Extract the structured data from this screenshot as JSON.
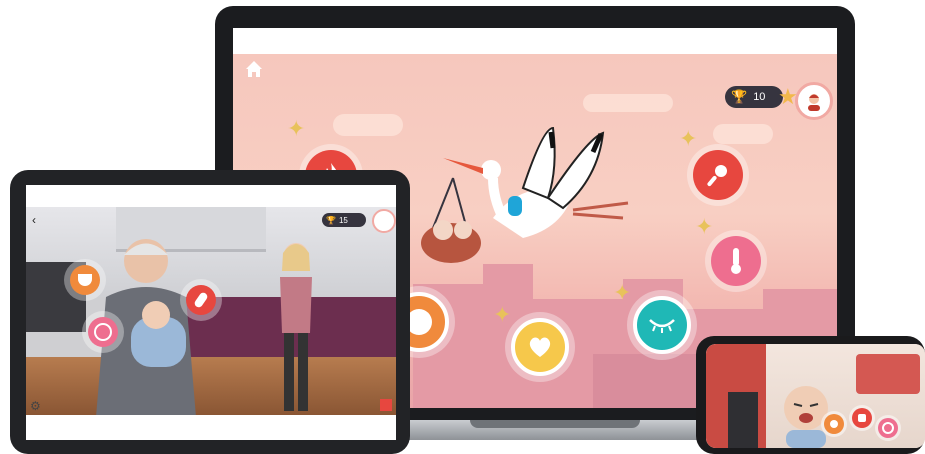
{
  "laptop": {
    "home_icon": "home-icon",
    "score": "10",
    "trophy_icon": "trophy-icon",
    "star_icon": "star-icon",
    "bubbles": [
      {
        "icon": "fire-icon",
        "color": "#e7473f"
      },
      {
        "icon": "rattle-icon",
        "color": "#e7473f"
      },
      {
        "icon": "thermometer-icon",
        "color": "#ee6e8f"
      },
      {
        "icon": "eye-closed-icon",
        "color": "#1fb8b6"
      },
      {
        "icon": "heart-icon",
        "color": "#f6c84b"
      },
      {
        "icon": "partial-bubble-icon",
        "color": "#f08a3c"
      }
    ]
  },
  "tablet": {
    "score": "15",
    "back_icon": "back-arrow-icon",
    "settings_icon": "gear-icon",
    "bubbles": [
      {
        "icon": "diaper-icon",
        "color": "#f08a3c"
      },
      {
        "icon": "bottle-icon",
        "color": "#e7473f"
      },
      {
        "icon": "food-icon",
        "color": "#ee6e8f"
      }
    ]
  },
  "phone": {
    "bubbles": [
      {
        "icon": "toy-icon",
        "color": "#f08a3c"
      },
      {
        "icon": "hand-icon",
        "color": "#e7473f"
      },
      {
        "icon": "food-icon",
        "color": "#ee6e8f"
      }
    ]
  },
  "colors": {
    "laptop_sky": "#f6c7bd",
    "laptop_city": "#e49aa5",
    "accent_red": "#e7473f",
    "accent_teal": "#1fb8b6",
    "accent_yellow": "#f6c84b"
  }
}
